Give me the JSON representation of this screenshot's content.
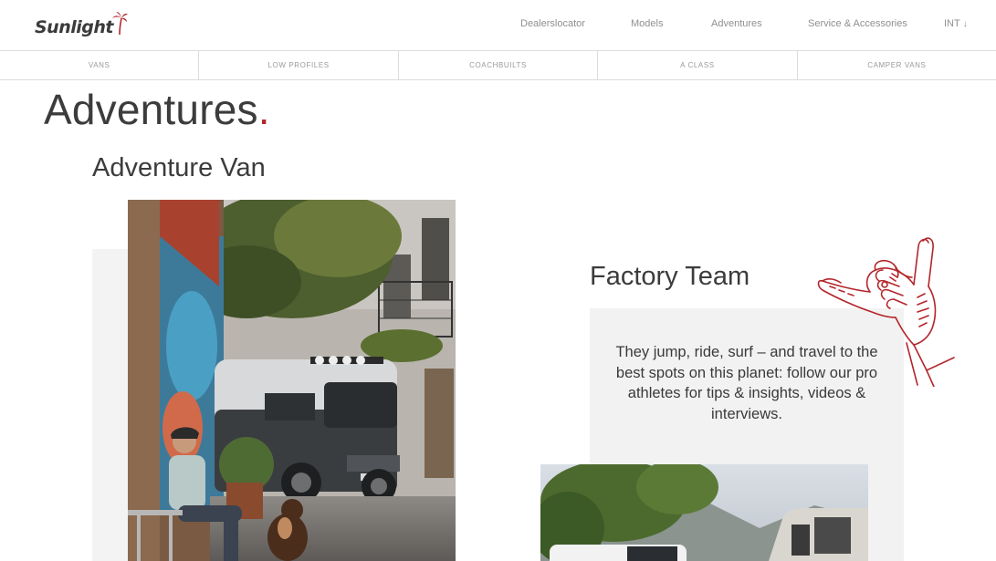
{
  "header": {
    "logo_text": "Sunlight",
    "nav": {
      "dealer": "Dealerslocator",
      "models": "Models",
      "adventures": "Adventures",
      "service": "Service & Accessories",
      "lang": "INT",
      "lang_arrow": "↓"
    }
  },
  "subnav": {
    "vans": "VANS",
    "low_profiles": "LOW PROFILES",
    "coachbuilts": "COACHBUILTS",
    "a_class": "A CLASS",
    "camper_vans": "CAMPER VANS"
  },
  "main": {
    "title": "Adventures",
    "title_dot": ".",
    "left_card": {
      "title": "Adventure Van"
    },
    "right_card": {
      "title": "Factory Team",
      "text": "They jump, ride, surf – and travel to the best spots on this planet: follow our pro athletes for tips & insights, videos & interviews."
    }
  },
  "colors": {
    "accent": "#b3262b",
    "text": "#3c3c3c",
    "muted": "#8f8f8f",
    "panel": "#f2f2f2"
  },
  "icons": {
    "logo": "palm-tree-icon",
    "illustration": "shaka-hand-icon"
  }
}
